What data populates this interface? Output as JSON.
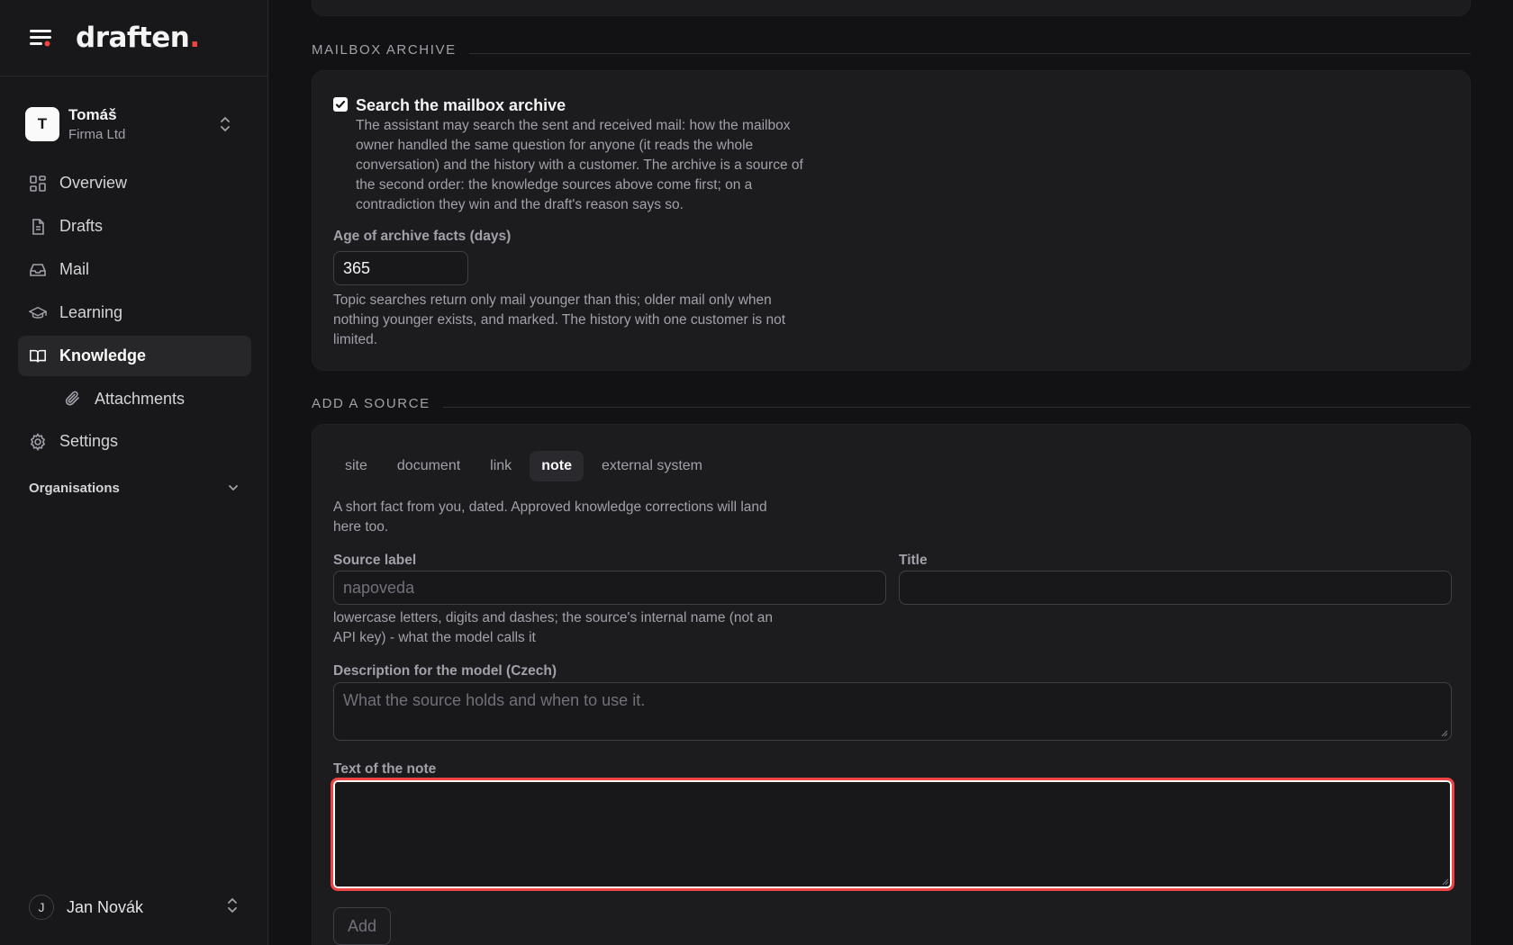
{
  "brand": {
    "logo": "draften",
    "logo_dot": "."
  },
  "org": {
    "initial": "T",
    "name": "Tomáš",
    "company": "Firma Ltd"
  },
  "nav": {
    "items": [
      {
        "label": "Overview",
        "icon": "grid-icon"
      },
      {
        "label": "Drafts",
        "icon": "document-icon"
      },
      {
        "label": "Mail",
        "icon": "inbox-icon"
      },
      {
        "label": "Learning",
        "icon": "graduation-cap-icon"
      },
      {
        "label": "Knowledge",
        "icon": "book-open-icon",
        "active": true
      },
      {
        "label": "Attachments",
        "icon": "paperclip-icon",
        "sub": true
      },
      {
        "label": "Settings",
        "icon": "gear-icon"
      }
    ],
    "organisations_label": "Organisations"
  },
  "user": {
    "initial": "J",
    "name": "Jan Novák"
  },
  "archive": {
    "section_title": "MAILBOX ARCHIVE",
    "checkbox_label": "Search the mailbox archive",
    "checked": true,
    "description": "The assistant may search the sent and received mail: how the mailbox owner handled the same question for anyone (it reads the whole conversation) and the history with a customer. The archive is a source of the second order: the knowledge sources above come first; on a contradiction they win and the draft's reason says so.",
    "age_label": "Age of archive facts (days)",
    "age_value": "365",
    "age_help": "Topic searches return only mail younger than this; older mail only when nothing younger exists, and marked. The history with one customer is not limited."
  },
  "add_source": {
    "section_title": "ADD A SOURCE",
    "tabs": [
      {
        "label": "site"
      },
      {
        "label": "document"
      },
      {
        "label": "link"
      },
      {
        "label": "note",
        "active": true
      },
      {
        "label": "external system"
      }
    ],
    "tab_description": "A short fact from you, dated. Approved knowledge corrections will land here too.",
    "source_label_label": "Source label",
    "source_label_placeholder": "napoveda",
    "title_label": "Title",
    "title_value": "",
    "source_label_help": "lowercase letters, digits and dashes; the source's internal name (not an API key) - what the model calls it",
    "description_label": "Description for the model (Czech)",
    "description_placeholder": "What the source holds and when to use it.",
    "note_label": "Text of the note",
    "note_value": "",
    "add_button": "Add"
  },
  "colors": {
    "accent": "#ef4444",
    "background": "#121214",
    "card": "#1c1c1f",
    "sidebar": "#18181b"
  }
}
